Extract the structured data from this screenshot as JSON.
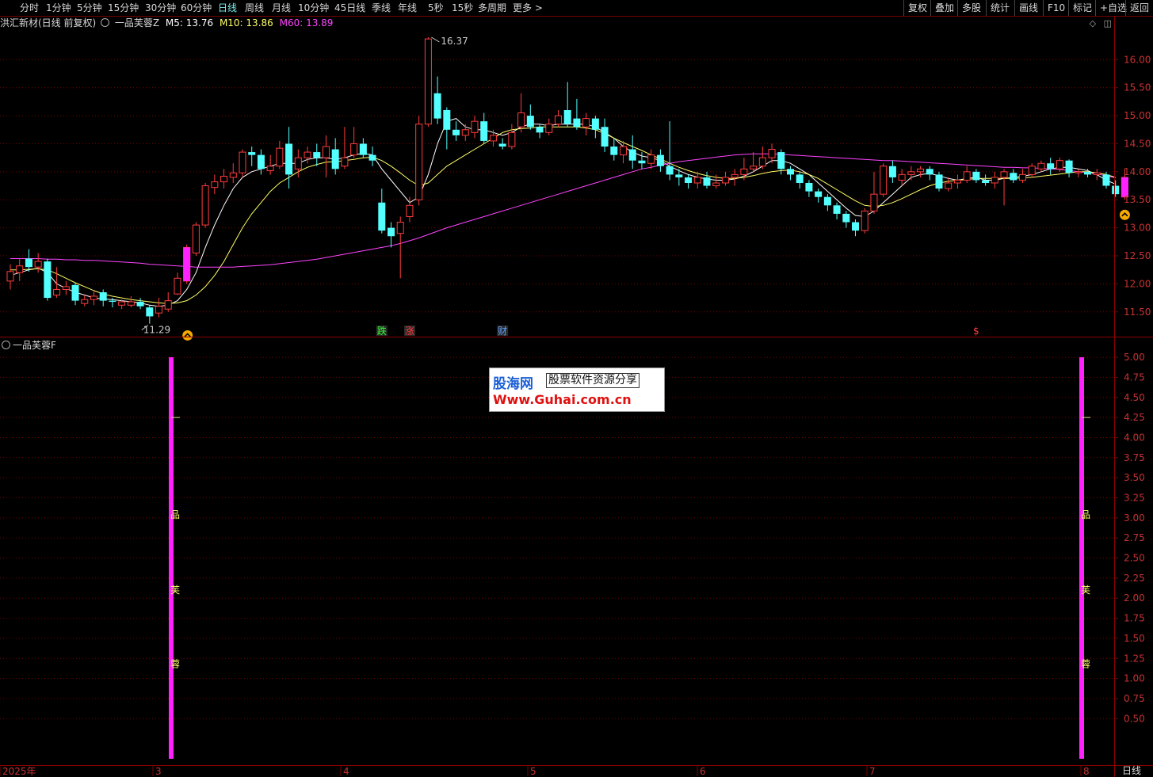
{
  "toolbar": {
    "periods": [
      "分时",
      "1分钟",
      "5分钟",
      "15分钟",
      "30分钟",
      "60分钟",
      "日线",
      "周线",
      "月线",
      "10分钟",
      "45日线",
      "季线",
      "年线",
      "5秒",
      "15秒",
      "多周期",
      "更多 >"
    ],
    "active_period": "日线",
    "right_buttons": [
      "复权",
      "叠加",
      "多股",
      "统计",
      "画线",
      "F10",
      "标记",
      "+自选",
      "返回"
    ]
  },
  "main_title": {
    "stock": "洪汇新材(日线 前复权)",
    "indicator": "一品芙蓉Z",
    "m5_label": "M5: 13.76",
    "m10_label": "M10: 13.86",
    "m60_label": "M60: 13.89"
  },
  "indicator_pane": {
    "title": "一品芙蓉F"
  },
  "colors": {
    "up": "#ff3c3c",
    "down": "#54ffff",
    "m5": "#ffffff",
    "m10": "#ffff66",
    "m60": "#ff44ff",
    "grid": "#7a0000",
    "axis_text": "#c83232",
    "signal_bar": "#ff22ff"
  },
  "chart_data": [
    {
      "type": "candlestick",
      "title": "洪汇新材(日线 前复权)",
      "ylim": [
        11.2,
        16.4
      ],
      "y_ticks": [
        "11.50",
        "12.00",
        "12.50",
        "13.00",
        "13.50",
        "14.00",
        "14.50",
        "15.00",
        "15.50",
        "16.00"
      ],
      "annotations": {
        "high": "16.37",
        "low": "11.29"
      },
      "event_markers": [
        "跌",
        "涨",
        "财",
        "$"
      ],
      "signal_icons": [
        "buy-arrow-1",
        "buy-arrow-2"
      ],
      "x_ticks": [
        "2025年",
        "3",
        "4",
        "5",
        "6",
        "7",
        "8"
      ],
      "candles": [
        [
          12.05,
          12.22,
          12.35,
          11.9
        ],
        [
          12.2,
          12.32,
          12.45,
          12.05
        ],
        [
          12.45,
          12.3,
          12.62,
          12.22
        ],
        [
          12.3,
          12.4,
          12.55,
          12.2
        ],
        [
          12.4,
          11.75,
          12.45,
          11.7
        ],
        [
          11.8,
          11.9,
          12.3,
          11.75
        ],
        [
          11.9,
          11.95,
          12.05,
          11.8
        ],
        [
          11.98,
          11.7,
          12.02,
          11.62
        ],
        [
          11.65,
          11.72,
          11.8,
          11.6
        ],
        [
          11.72,
          11.78,
          11.88,
          11.62
        ],
        [
          11.85,
          11.7,
          11.9,
          11.6
        ],
        [
          11.7,
          11.68,
          11.75,
          11.58
        ],
        [
          11.62,
          11.68,
          11.72,
          11.55
        ],
        [
          11.62,
          11.68,
          11.78,
          11.58
        ],
        [
          11.68,
          11.6,
          11.75,
          11.55
        ],
        [
          11.58,
          11.42,
          11.62,
          11.29
        ],
        [
          11.48,
          11.6,
          11.75,
          11.4
        ],
        [
          11.55,
          11.7,
          11.85,
          11.5
        ],
        [
          11.82,
          12.1,
          12.2,
          11.8
        ],
        [
          12.05,
          12.65,
          12.7,
          12.0
        ],
        [
          12.55,
          13.05,
          13.1,
          12.5
        ],
        [
          13.05,
          13.75,
          13.8,
          13.0
        ],
        [
          13.72,
          13.82,
          13.95,
          13.6
        ],
        [
          13.82,
          13.92,
          14.05,
          13.7
        ],
        [
          13.9,
          13.98,
          14.15,
          13.8
        ],
        [
          13.98,
          14.35,
          14.4,
          13.9
        ],
        [
          14.35,
          14.3,
          14.45,
          14.1
        ],
        [
          14.3,
          14.05,
          14.4,
          13.95
        ],
        [
          14.02,
          14.1,
          14.3,
          13.95
        ],
        [
          14.1,
          14.42,
          14.55,
          14.05
        ],
        [
          14.5,
          13.95,
          14.8,
          13.7
        ],
        [
          14.05,
          14.25,
          14.4,
          13.9
        ],
        [
          14.25,
          14.35,
          14.45,
          14.15
        ],
        [
          14.35,
          14.25,
          14.5,
          14.1
        ],
        [
          14.25,
          14.45,
          14.65,
          13.9
        ],
        [
          14.4,
          14.05,
          14.6,
          13.95
        ],
        [
          14.1,
          14.25,
          14.8,
          14.05
        ],
        [
          14.3,
          14.5,
          14.8,
          14.25
        ],
        [
          14.5,
          14.3,
          14.6,
          14.25
        ],
        [
          14.3,
          14.2,
          14.45,
          14.1
        ],
        [
          13.45,
          12.95,
          13.7,
          12.9
        ],
        [
          13.0,
          12.85,
          13.1,
          12.65
        ],
        [
          12.9,
          13.1,
          13.2,
          12.1
        ],
        [
          13.2,
          13.4,
          13.55,
          13.1
        ],
        [
          13.5,
          14.85,
          15.0,
          13.4
        ],
        [
          14.85,
          16.37,
          16.4,
          14.8
        ],
        [
          15.4,
          14.95,
          15.7,
          14.85
        ],
        [
          15.1,
          14.75,
          15.15,
          14.4
        ],
        [
          14.75,
          14.65,
          14.9,
          14.55
        ],
        [
          14.65,
          14.75,
          14.85,
          14.55
        ],
        [
          14.7,
          14.9,
          15.0,
          14.6
        ],
        [
          14.9,
          14.55,
          15.05,
          14.5
        ],
        [
          14.55,
          14.65,
          14.75,
          14.45
        ],
        [
          14.5,
          14.45,
          14.6,
          14.4
        ],
        [
          14.45,
          14.7,
          14.85,
          14.4
        ],
        [
          14.8,
          15.05,
          15.4,
          14.7
        ],
        [
          15.0,
          14.8,
          15.2,
          14.75
        ],
        [
          14.8,
          14.7,
          14.85,
          14.6
        ],
        [
          14.7,
          14.85,
          14.95,
          14.65
        ],
        [
          14.85,
          15.0,
          15.1,
          14.8
        ],
        [
          15.1,
          14.85,
          15.6,
          14.8
        ],
        [
          14.95,
          14.8,
          15.3,
          14.75
        ],
        [
          14.8,
          14.95,
          15.05,
          14.65
        ],
        [
          14.95,
          14.75,
          15.0,
          14.6
        ],
        [
          14.8,
          14.45,
          14.95,
          14.35
        ],
        [
          14.45,
          14.3,
          14.6,
          14.2
        ],
        [
          14.3,
          14.45,
          14.55,
          14.15
        ],
        [
          14.4,
          14.2,
          14.65,
          14.05
        ],
        [
          14.2,
          14.15,
          14.35,
          14.05
        ],
        [
          14.15,
          14.3,
          14.4,
          14.05
        ],
        [
          14.3,
          14.1,
          14.4,
          14.0
        ],
        [
          14.1,
          13.95,
          14.9,
          13.85
        ],
        [
          13.95,
          13.9,
          14.05,
          13.75
        ],
        [
          13.9,
          13.8,
          13.95,
          13.7
        ],
        [
          13.8,
          13.9,
          14.0,
          13.7
        ],
        [
          13.9,
          13.75,
          14.0,
          13.7
        ],
        [
          13.75,
          13.8,
          13.95,
          13.7
        ],
        [
          13.8,
          13.9,
          14.0,
          13.75
        ],
        [
          13.9,
          13.95,
          14.05,
          13.75
        ],
        [
          13.95,
          14.05,
          14.25,
          13.85
        ],
        [
          14.05,
          14.1,
          14.35,
          14.0
        ],
        [
          14.1,
          14.25,
          14.45,
          14.05
        ],
        [
          14.25,
          14.4,
          14.5,
          14.15
        ],
        [
          14.35,
          14.05,
          14.4,
          13.95
        ],
        [
          14.05,
          13.95,
          14.1,
          13.85
        ],
        [
          13.95,
          13.8,
          14.0,
          13.7
        ],
        [
          13.8,
          13.65,
          13.85,
          13.55
        ],
        [
          13.65,
          13.55,
          13.7,
          13.45
        ],
        [
          13.55,
          13.4,
          13.6,
          13.3
        ],
        [
          13.4,
          13.25,
          13.45,
          13.15
        ],
        [
          13.25,
          13.1,
          13.3,
          13.0
        ],
        [
          13.1,
          12.95,
          13.15,
          12.85
        ],
        [
          12.95,
          13.3,
          13.35,
          12.9
        ],
        [
          13.3,
          13.6,
          14.0,
          13.25
        ],
        [
          13.6,
          14.1,
          14.15,
          13.55
        ],
        [
          14.1,
          13.9,
          14.2,
          13.8
        ],
        [
          13.85,
          13.95,
          14.05,
          13.75
        ],
        [
          13.95,
          14.0,
          14.1,
          13.85
        ],
        [
          14.0,
          14.05,
          14.1,
          13.9
        ],
        [
          14.05,
          13.95,
          14.1,
          13.85
        ],
        [
          13.95,
          13.7,
          14.0,
          13.65
        ],
        [
          13.7,
          13.8,
          13.9,
          13.65
        ],
        [
          13.8,
          13.85,
          13.95,
          13.7
        ],
        [
          13.85,
          14.0,
          14.1,
          13.8
        ],
        [
          14.0,
          13.85,
          14.05,
          13.8
        ],
        [
          13.85,
          13.8,
          13.95,
          13.75
        ],
        [
          13.8,
          13.9,
          14.0,
          13.7
        ],
        [
          13.9,
          14.0,
          14.05,
          13.4
        ],
        [
          13.98,
          13.85,
          14.05,
          13.8
        ],
        [
          13.85,
          13.95,
          14.05,
          13.8
        ],
        [
          13.95,
          14.1,
          14.15,
          13.9
        ],
        [
          14.05,
          14.15,
          14.2,
          14.0
        ],
        [
          14.15,
          14.05,
          14.25,
          13.95
        ],
        [
          14.05,
          14.2,
          14.25,
          14.0
        ],
        [
          14.2,
          13.98,
          14.22,
          13.9
        ],
        [
          13.98,
          14.0,
          14.05,
          13.9
        ],
        [
          14.0,
          13.95,
          14.05,
          13.9
        ],
        [
          13.95,
          13.98,
          14.05,
          13.85
        ],
        [
          13.95,
          13.75,
          14.0,
          13.7
        ],
        [
          13.75,
          13.6,
          13.85,
          13.55
        ],
        [
          13.55,
          13.9,
          14.05,
          13.5
        ]
      ],
      "series": [
        {
          "name": "M5",
          "values": [
            12.15,
            12.2,
            12.25,
            12.28,
            12.2,
            12.0,
            11.92,
            11.85,
            11.8,
            11.75,
            11.73,
            11.72,
            11.7,
            11.68,
            11.66,
            11.62,
            11.6,
            11.62,
            11.7,
            11.9,
            12.2,
            12.65,
            13.05,
            13.4,
            13.7,
            13.9,
            14.0,
            14.05,
            14.1,
            14.15,
            14.15,
            14.15,
            14.22,
            14.25,
            14.25,
            14.22,
            14.25,
            14.3,
            14.33,
            14.3,
            14.05,
            13.85,
            13.65,
            13.45,
            13.55,
            13.95,
            14.5,
            14.9,
            14.95,
            14.8,
            14.75,
            14.75,
            14.7,
            14.65,
            14.7,
            14.8,
            14.85,
            14.85,
            14.82,
            14.85,
            14.85,
            14.85,
            14.85,
            14.8,
            14.7,
            14.6,
            14.45,
            14.35,
            14.28,
            14.25,
            14.2,
            14.1,
            14.02,
            13.95,
            13.9,
            13.87,
            13.85,
            13.85,
            13.87,
            13.92,
            14.0,
            14.1,
            14.2,
            14.2,
            14.15,
            14.05,
            13.95,
            13.8,
            13.65,
            13.5,
            13.35,
            13.22,
            13.2,
            13.3,
            13.45,
            13.6,
            13.75,
            13.9,
            13.95,
            13.97,
            13.93,
            13.88,
            13.85,
            13.88,
            13.9,
            13.85,
            13.85,
            13.88,
            13.9,
            13.92,
            13.95,
            14.0,
            14.05,
            14.08,
            14.08,
            14.05,
            14.02,
            13.95,
            13.85,
            13.78
          ]
        },
        {
          "name": "M10",
          "values": [
            12.25,
            12.25,
            12.26,
            12.27,
            12.25,
            12.18,
            12.1,
            12.02,
            11.95,
            11.88,
            11.82,
            11.78,
            11.75,
            11.72,
            11.7,
            11.68,
            11.66,
            11.65,
            11.66,
            11.7,
            11.8,
            11.95,
            12.15,
            12.4,
            12.7,
            13.0,
            13.25,
            13.45,
            13.65,
            13.8,
            13.9,
            14.0,
            14.08,
            14.13,
            14.17,
            14.18,
            14.2,
            14.22,
            14.25,
            14.26,
            14.2,
            14.1,
            13.98,
            13.85,
            13.75,
            13.8,
            13.95,
            14.1,
            14.2,
            14.3,
            14.4,
            14.5,
            14.6,
            14.7,
            14.75,
            14.77,
            14.78,
            14.8,
            14.8,
            14.8,
            14.8,
            14.8,
            14.78,
            14.75,
            14.68,
            14.6,
            14.52,
            14.45,
            14.38,
            14.3,
            14.23,
            14.15,
            14.08,
            14.02,
            13.97,
            13.93,
            13.9,
            13.88,
            13.88,
            13.9,
            13.93,
            13.97,
            14.0,
            14.02,
            14.03,
            14.0,
            13.95,
            13.88,
            13.78,
            13.68,
            13.58,
            13.48,
            13.4,
            13.38,
            13.4,
            13.45,
            13.52,
            13.6,
            13.68,
            13.75,
            13.8,
            13.83,
            13.85,
            13.86,
            13.88,
            13.88,
            13.88,
            13.88,
            13.88,
            13.89,
            13.9,
            13.92,
            13.94,
            13.96,
            13.98,
            14.0,
            14.0,
            13.98,
            13.95,
            13.9
          ]
        },
        {
          "name": "M60",
          "values": [
            12.45,
            12.45,
            12.45,
            12.45,
            12.44,
            12.44,
            12.43,
            12.43,
            12.42,
            12.42,
            12.41,
            12.4,
            12.39,
            12.38,
            12.37,
            12.35,
            12.34,
            12.33,
            12.32,
            12.31,
            12.3,
            12.3,
            12.3,
            12.3,
            12.3,
            12.31,
            12.32,
            12.33,
            12.34,
            12.36,
            12.38,
            12.4,
            12.42,
            12.44,
            12.47,
            12.5,
            12.53,
            12.56,
            12.59,
            12.62,
            12.65,
            12.68,
            12.72,
            12.77,
            12.82,
            12.88,
            12.94,
            13.0,
            13.05,
            13.1,
            13.15,
            13.2,
            13.25,
            13.3,
            13.35,
            13.4,
            13.45,
            13.5,
            13.55,
            13.6,
            13.65,
            13.7,
            13.75,
            13.8,
            13.85,
            13.9,
            13.95,
            14.0,
            14.05,
            14.08,
            14.12,
            14.15,
            14.18,
            14.2,
            14.22,
            14.24,
            14.26,
            14.28,
            14.3,
            14.31,
            14.32,
            14.32,
            14.32,
            14.31,
            14.3,
            14.29,
            14.28,
            14.27,
            14.26,
            14.25,
            14.24,
            14.23,
            14.22,
            14.21,
            14.2,
            14.2,
            14.19,
            14.18,
            14.17,
            14.16,
            14.15,
            14.14,
            14.13,
            14.12,
            14.11,
            14.1,
            14.09,
            14.08,
            14.08,
            14.07,
            14.07,
            14.06,
            14.05,
            14.04,
            14.02,
            14.0,
            13.98,
            13.96,
            13.93,
            13.89
          ]
        }
      ]
    },
    {
      "type": "bar",
      "title": "一品芙蓉F",
      "ylim": [
        0,
        5.05
      ],
      "y_ticks": [
        "0.50",
        "0.75",
        "1.00",
        "1.25",
        "1.50",
        "1.75",
        "2.00",
        "2.25",
        "2.50",
        "2.75",
        "3.00",
        "3.25",
        "3.50",
        "3.75",
        "4.00",
        "4.25",
        "4.50",
        "4.75",
        "5.00"
      ],
      "signal_bars": [
        {
          "index": 19,
          "value": 5.0,
          "mark": 4.25,
          "labels": [
            "品",
            "芙",
            "蓉"
          ]
        },
        {
          "index": 121,
          "value": 5.0,
          "mark": 4.25,
          "labels": [
            "品",
            "芙",
            "蓉"
          ]
        }
      ]
    }
  ],
  "watermark": {
    "brand": "股海网",
    "slogan": "股票软件资源分享",
    "url": "Www.Guhai.com.cn"
  },
  "status": {
    "period_label": "日线"
  }
}
